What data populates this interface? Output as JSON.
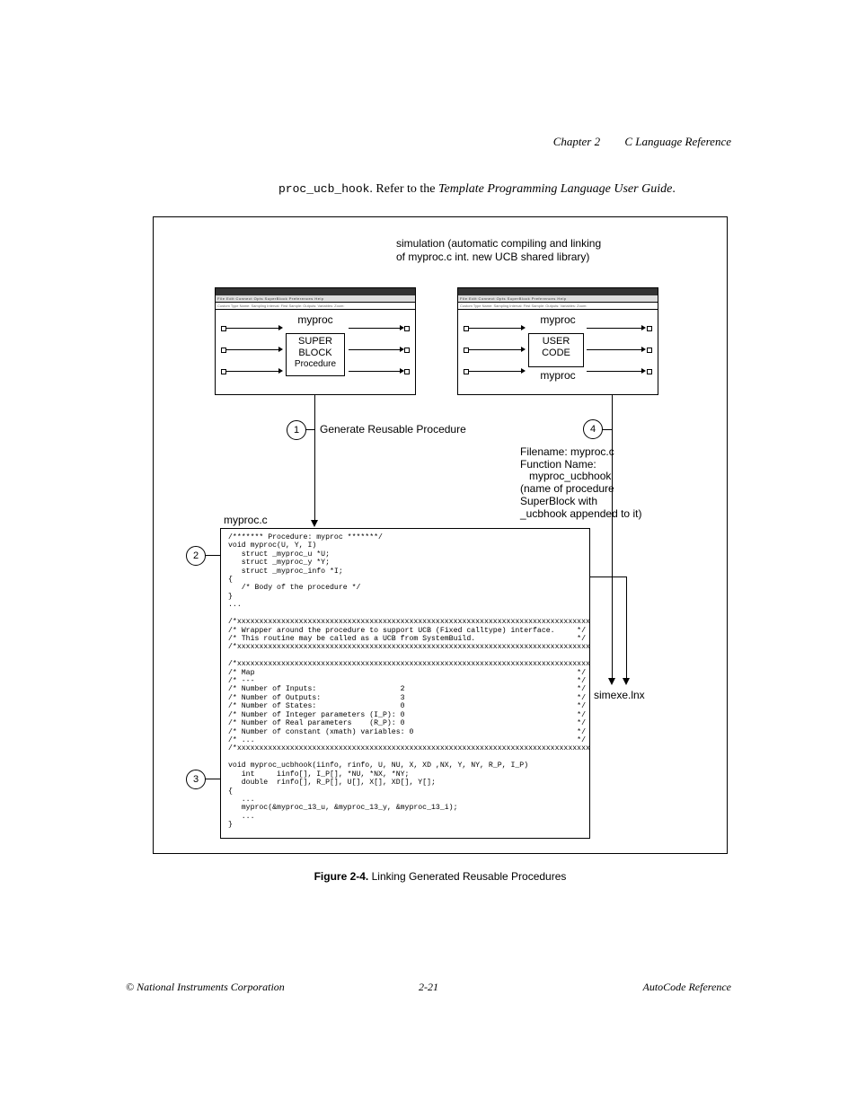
{
  "header": {
    "chapter": "Chapter 2",
    "title": "C Language Reference"
  },
  "intro": {
    "code": "proc_ucb_hook",
    "text1": ". Refer to the ",
    "text2": "Template Programming Language User Guide",
    "text3": "."
  },
  "figure": {
    "sim_text_line1": "simulation (automatic compiling and linking",
    "sim_text_line2": "of myproc.c int. new UCB shared library)",
    "win_menu": "File  Edit  Connect  Opts  SuperBlock  Preferences  Help",
    "win_sub": "   Custom Type Name:  Sampling Interval: First Sample:  Outputs: Variables:  Zoom:",
    "left_top": "myproc",
    "left_block_l1": "SUPER",
    "left_block_l2": "BLOCK",
    "left_block_l3": "Procedure",
    "right_top": "myproc",
    "right_block_l1": "USER",
    "right_block_l2": "CODE",
    "right_myproc": "myproc",
    "step1": "1",
    "step2": "2",
    "step3": "3",
    "step4": "4",
    "gen_label": "Generate Reusable Procedure",
    "fn_l1": "Filename: myproc.c",
    "fn_l2": "Function Name:",
    "fn_l3": "   myproc_ucbhook",
    "fn_l4": "(name of procedure",
    "fn_l5": "SuperBlock with",
    "fn_l6": "_ucbhook appended to it)",
    "myproc_c": "myproc.c",
    "simexe": "simexe.lnx",
    "code": "/******* Procedure: myproc *******/\nvoid myproc(U, Y, I)\n   struct _myproc_u *U;\n   struct _myproc_y *Y;\n   struct _myproc_info *I;\n{\n   /* Body of the procedure */\n}\n...\n\n/*xxxxxxxxxxxxxxxxxxxxxxxxxxxxxxxxxxxxxxxxxxxxxxxxxxxxxxxxxxxxxxxxxxxxxxxxxxxxxxxx/\n/* Wrapper around the procedure to support UCB (Fixed calltype) interface.     */\n/* This routine may be called as a UCB from SystemBuild.                       */\n/*xxxxxxxxxxxxxxxxxxxxxxxxxxxxxxxxxxxxxxxxxxxxxxxxxxxxxxxxxxxxxxxxxxxxxxxxxxxxxxxx/\n\n/*xxxxxxxxxxxxxxxxxxxxxxxxxxxxxxxxxxxxxxxxxxxxxxxxxxxxxxxxxxxxxxxxxxxxxxxxxxxxxxxx/\n/* Map                                                                         */\n/* ---                                                                         */\n/* Number of Inputs:                   2                                       */\n/* Number of Outputs:                  3                                       */\n/* Number of States:                   0                                       */\n/* Number of Integer parameters (I_P): 0                                       */\n/* Number of Real parameters    (R_P): 0                                       */\n/* Number of constant (xmath) variables: 0                                     */\n/* ...                                                                         */\n/*xxxxxxxxxxxxxxxxxxxxxxxxxxxxxxxxxxxxxxxxxxxxxxxxxxxxxxxxxxxxxxxxxxxxxxxxxxxxxxxx/\n\nvoid myproc_ucbhook(iinfo, rinfo, U, NU, X, XD ,NX, Y, NY, R_P, I_P)\n   int     iinfo[], I_P[], *NU, *NX, *NY;\n   double  rinfo[], R_P[], U[], X[], XD[], Y[];\n{\n   ...\n   myproc(&myproc_13_u, &myproc_13_y, &myproc_13_i);\n   ...\n}"
  },
  "caption": {
    "label": "Figure 2-4.",
    "text": "  Linking Generated Reusable Procedures"
  },
  "footer": {
    "left": "© National Instruments Corporation",
    "center": "2-21",
    "right": "AutoCode Reference"
  }
}
